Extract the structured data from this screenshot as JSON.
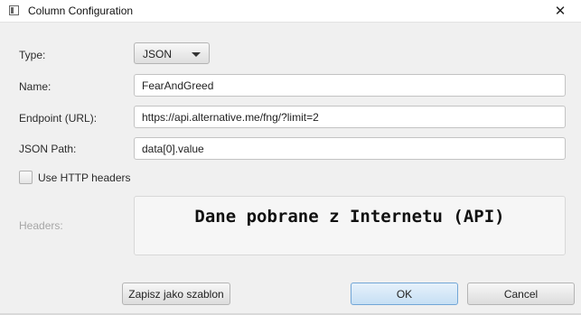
{
  "window": {
    "title": "Column Configuration",
    "close_glyph": "✕",
    "icon": "window-app-icon"
  },
  "form": {
    "type_label": "Type:",
    "type_value": "JSON",
    "name_label": "Name:",
    "name_value": "FearAndGreed",
    "endpoint_label": "Endpoint (URL):",
    "endpoint_value": "https://api.alternative.me/fng/?limit=2",
    "json_path_label": "JSON Path:",
    "json_path_value": "data[0].value",
    "use_http_headers_label": "Use HTTP headers",
    "use_http_headers_checked": false,
    "headers_label": "Headers:",
    "headers_banner": "Dane pobrane z Internetu (API)"
  },
  "buttons": {
    "save_template": "Zapisz jako szablon",
    "ok": "OK",
    "cancel": "Cancel"
  },
  "colors": {
    "ok_accent": "#72a6d6",
    "background": "#f0f0f0"
  }
}
